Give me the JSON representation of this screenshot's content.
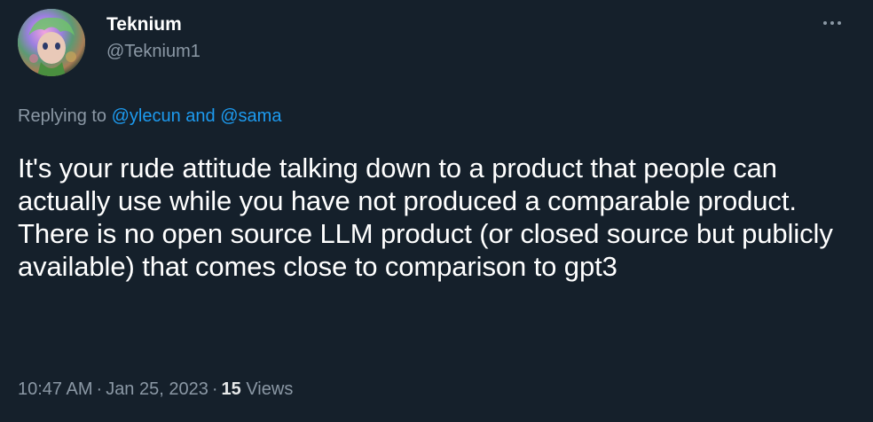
{
  "author": {
    "display_name": "Teknium",
    "handle": "@Teknium1",
    "avatar_icon": "avatar-image"
  },
  "more_icon": "more-horizontal-icon",
  "reply_context": {
    "prefix": "Replying to ",
    "mention_1": "@ylecun",
    "conjunction": " and ",
    "mention_2": "@sama"
  },
  "tweet": {
    "text": "It's your rude attitude talking down to a product that people can actually use while you have not produced a comparable product. There is no open source LLM product (or closed source but publicly available) that comes close to comparison to gpt3"
  },
  "meta": {
    "time": "10:47 AM",
    "separator": "·",
    "date": "Jan 25, 2023",
    "views_count": "15",
    "views_label": "Views"
  },
  "colors": {
    "background": "#15202b",
    "text_primary": "#ffffff",
    "text_secondary": "#8b98a5",
    "link": "#1d9bf0"
  }
}
